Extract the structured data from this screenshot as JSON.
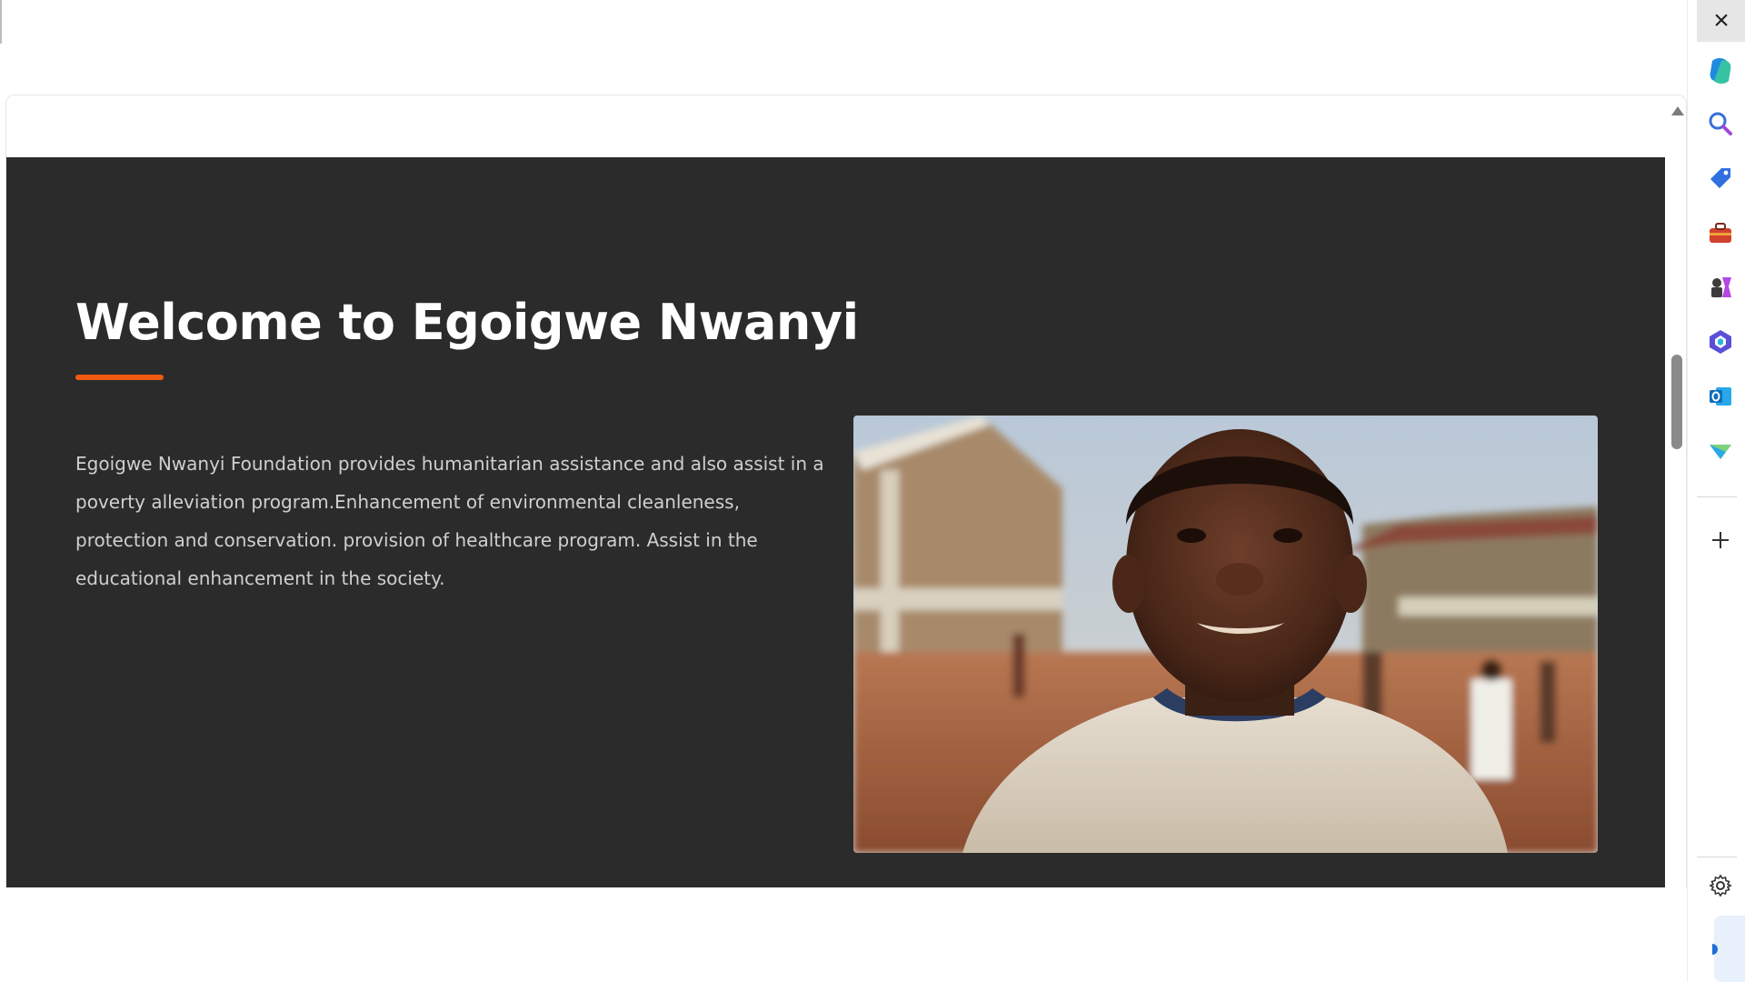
{
  "hero": {
    "title": "Welcome to Egoigwe Nwanyi",
    "description": "Egoigwe Nwanyi Foundation provides humanitarian assistance and also assist in a poverty alleviation program.Enhancement of environmental cleanleness, protection and conservation. provision of healthcare program. Assist in the educational enhancement in the society.",
    "accent_color": "#f05a12",
    "background_color": "#2b2b2b",
    "image_icon": "photo-smiling-boy"
  },
  "sidebar": {
    "close_icon": "close-icon",
    "items": [
      {
        "icon": "copilot-icon",
        "color": "#1f8ae0"
      },
      {
        "icon": "search-icon",
        "color": "#3b6fd8"
      },
      {
        "icon": "shopping-tag-icon",
        "color": "#2f6fe0"
      },
      {
        "icon": "toolbox-icon",
        "color": "#d2412e"
      },
      {
        "icon": "games-icon",
        "color": "#7d3cdf"
      },
      {
        "icon": "microsoft-365-icon",
        "color": "#5a4fd6"
      },
      {
        "icon": "outlook-icon",
        "color": "#0f6cbd"
      },
      {
        "icon": "drop-icon",
        "color": "#2aa7e5"
      }
    ],
    "add_icon": "plus-icon",
    "settings_icon": "gear-icon"
  }
}
